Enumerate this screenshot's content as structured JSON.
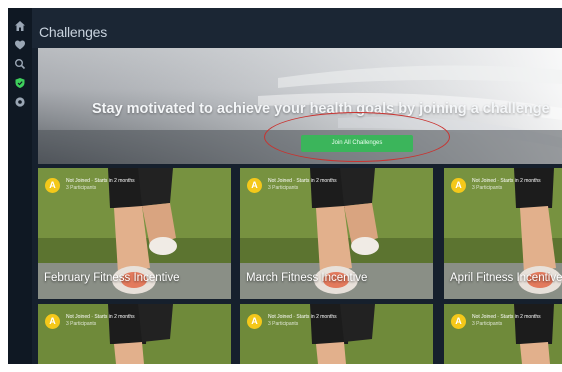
{
  "header": {
    "title": "Challenges"
  },
  "sidebar": {
    "items": [
      {
        "icon": "home-icon"
      },
      {
        "icon": "heart-icon"
      },
      {
        "icon": "search-icon"
      },
      {
        "icon": "shield-icon",
        "active": true
      },
      {
        "icon": "settings-icon"
      }
    ]
  },
  "hero": {
    "headline": "Stay motivated to achieve your health goals by joining a challenge",
    "button_label": "Join All Challenges"
  },
  "cards": [
    {
      "status_letter": "A",
      "status": "Not Joined · Starts in 2 months",
      "participants": "3 Participants",
      "title": "February Fitness Incentive"
    },
    {
      "status_letter": "A",
      "status": "Not Joined · Starts in 2 months",
      "participants": "3 Participants",
      "title": "March Fitness Incentive"
    },
    {
      "status_letter": "A",
      "status": "Not Joined · Starts in 2 months",
      "participants": "3 Participants",
      "title": "April Fitness Incentive"
    },
    {
      "status_letter": "A",
      "status": "Not Joined · Starts in 2 months",
      "participants": "3 Participants",
      "title": ""
    },
    {
      "status_letter": "A",
      "status": "Not Joined · Starts in 2 months",
      "participants": "3 Participants",
      "title": ""
    },
    {
      "status_letter": "A",
      "status": "Not Joined · Starts in 2 months",
      "participants": "3 Participants",
      "title": ""
    }
  ],
  "colors": {
    "app_bg": "#16202d",
    "sidebar_bg": "#0f1823",
    "accent_green": "#3bb55b",
    "status_yellow": "#f4c81a",
    "annotation_red": "#c9322f"
  }
}
